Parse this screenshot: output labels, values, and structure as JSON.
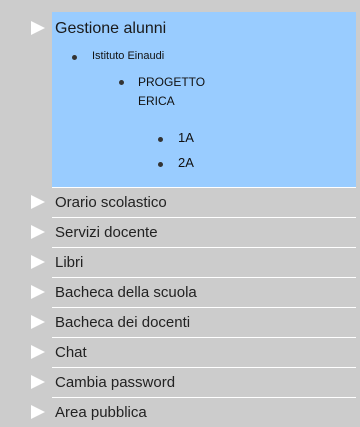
{
  "menu": {
    "active": {
      "label": "Gestione alunni",
      "tree": {
        "school": "Istituto Einaudi",
        "project": "PROGETTO ERICA",
        "classes": [
          "1A",
          "2A"
        ]
      }
    },
    "items": [
      {
        "label": "Orario scolastico"
      },
      {
        "label": "Servizi docente"
      },
      {
        "label": "Libri"
      },
      {
        "label": "Bacheca della scuola"
      },
      {
        "label": "Bacheca dei docenti"
      },
      {
        "label": "Chat"
      },
      {
        "label": "Cambia password"
      },
      {
        "label": "Area pubblica"
      }
    ]
  },
  "colors": {
    "background": "#cccccc",
    "active_bg": "#99ccff",
    "arrow": "#ffffff"
  },
  "icons": {
    "arrow": "triangle-right-icon",
    "bullet": "bullet-icon"
  }
}
